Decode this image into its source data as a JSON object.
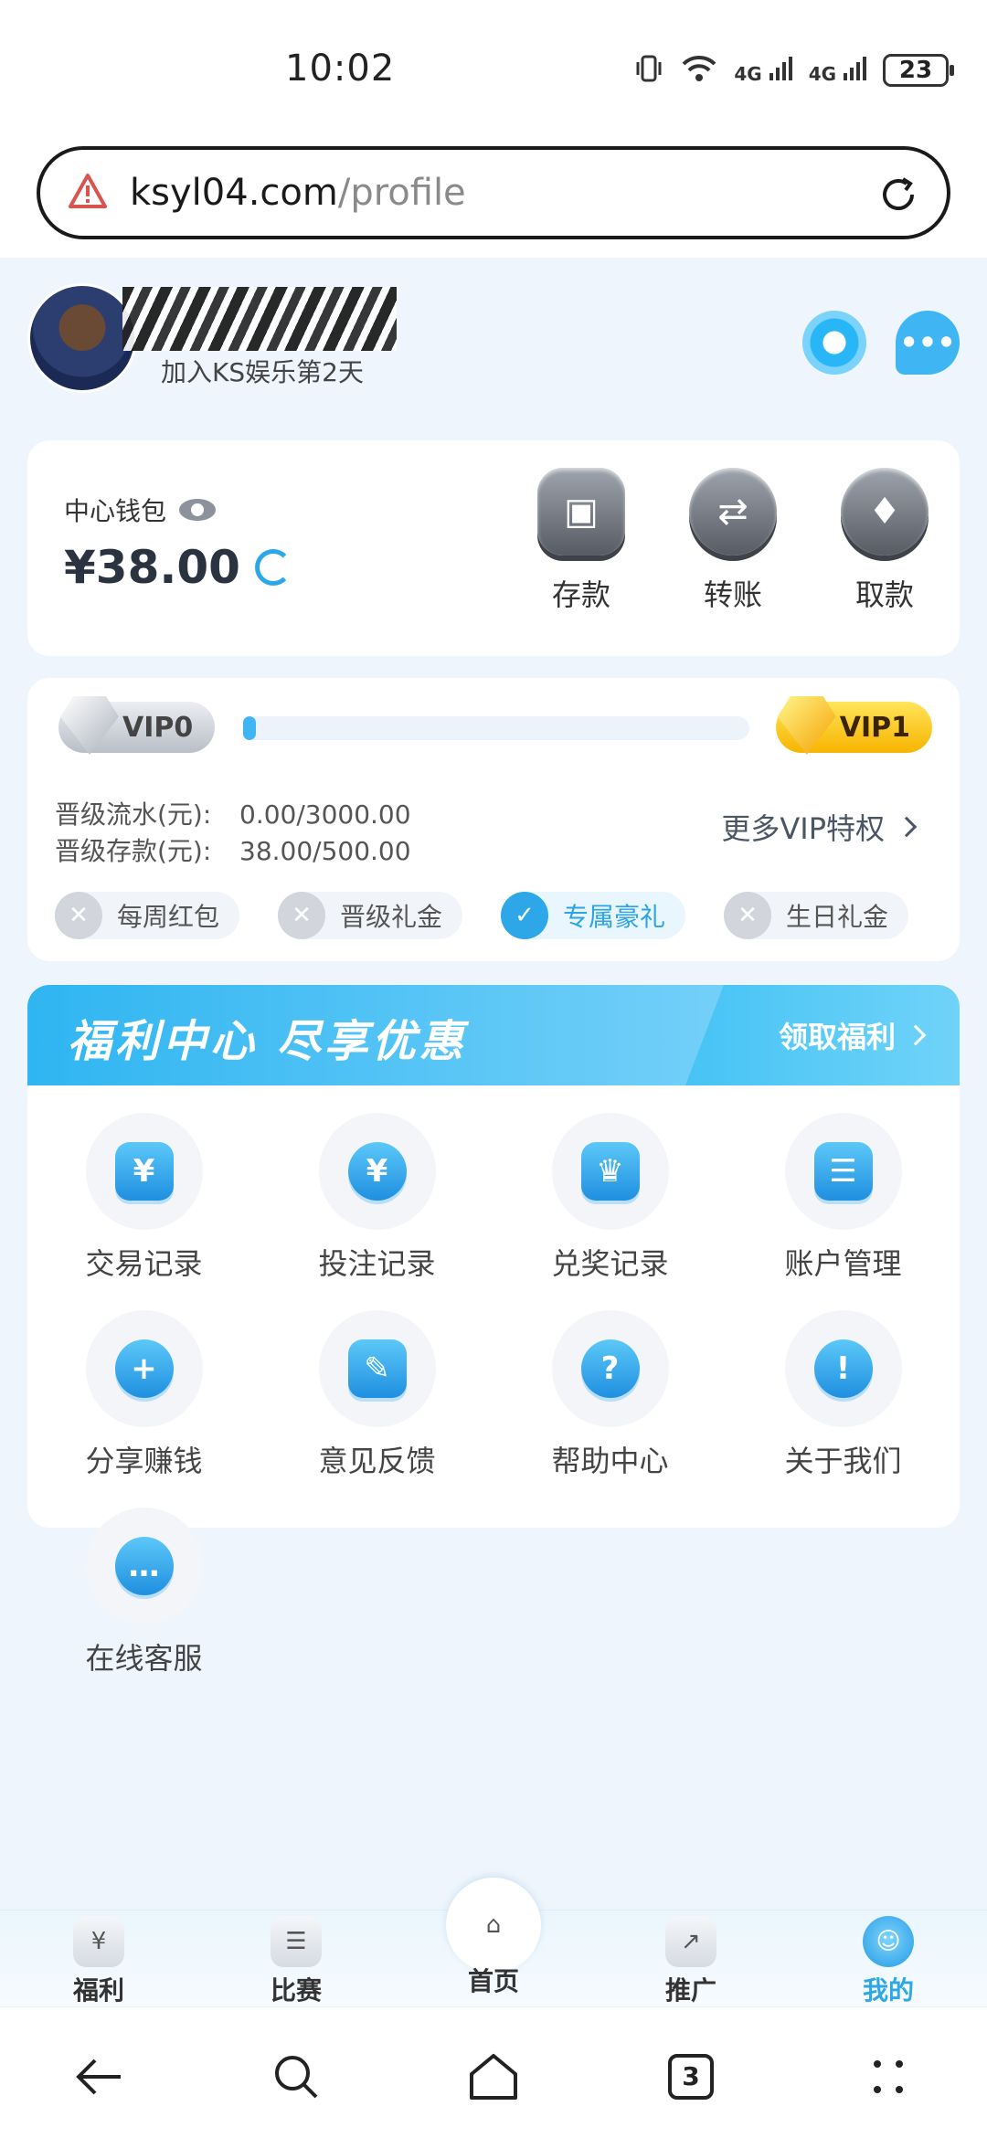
{
  "status_bar": {
    "time": "10:02",
    "network1": "4G",
    "network2": "4G",
    "battery": "23"
  },
  "browser": {
    "url_host": "ksyl04.com",
    "url_path": "/profile",
    "tab_count": "3"
  },
  "profile": {
    "join_text": "加入KS娱乐第2天"
  },
  "wallet": {
    "label": "中心钱包",
    "balance": "¥38.00",
    "actions": [
      {
        "label": "存款",
        "icon": "wallet-icon"
      },
      {
        "label": "转账",
        "icon": "transfer-icon"
      },
      {
        "label": "取款",
        "icon": "diamond-icon"
      }
    ]
  },
  "vip": {
    "current": "VIP0",
    "next": "VIP1",
    "progress": 0.0,
    "turnover_label": "晋级流水(元):",
    "turnover_value": "0.00/3000.00",
    "deposit_label": "晋级存款(元):",
    "deposit_value": "38.00/500.00",
    "more_label": "更多VIP特权",
    "perks": [
      {
        "label": "每周红包",
        "active": false
      },
      {
        "label": "晋级礼金",
        "active": false
      },
      {
        "label": "专属豪礼",
        "active": true
      },
      {
        "label": "生日礼金",
        "active": false
      }
    ]
  },
  "benefits": {
    "title": "福利中心 尽享优惠",
    "claim_label": "领取福利"
  },
  "menu": [
    {
      "label": "交易记录",
      "icon": "transaction-record-icon",
      "glyph": "¥"
    },
    {
      "label": "投注记录",
      "icon": "bet-record-icon",
      "glyph": "¥"
    },
    {
      "label": "兑奖记录",
      "icon": "prize-record-icon",
      "glyph": "♛"
    },
    {
      "label": "账户管理",
      "icon": "account-management-icon",
      "glyph": "☰"
    },
    {
      "label": "分享赚钱",
      "icon": "share-earn-icon",
      "glyph": "+"
    },
    {
      "label": "意见反馈",
      "icon": "feedback-icon",
      "glyph": "✎"
    },
    {
      "label": "帮助中心",
      "icon": "help-center-icon",
      "glyph": "?"
    },
    {
      "label": "关于我们",
      "icon": "about-us-icon",
      "glyph": "!"
    },
    {
      "label": "在线客服",
      "icon": "online-service-icon",
      "glyph": "…"
    }
  ],
  "tabbar": [
    {
      "label": "福利",
      "icon": "welfare-icon",
      "glyph": "¥"
    },
    {
      "label": "比赛",
      "icon": "match-icon",
      "glyph": "☰"
    },
    {
      "label": "首页",
      "icon": "home-icon",
      "glyph": "⌂"
    },
    {
      "label": "推广",
      "icon": "promote-icon",
      "glyph": "↗"
    },
    {
      "label": "我的",
      "icon": "mine-icon",
      "glyph": "☺"
    }
  ],
  "colors": {
    "accent": "#2ea7e8",
    "page_bg": "#eef5fc",
    "vip1": "#f7b400"
  }
}
